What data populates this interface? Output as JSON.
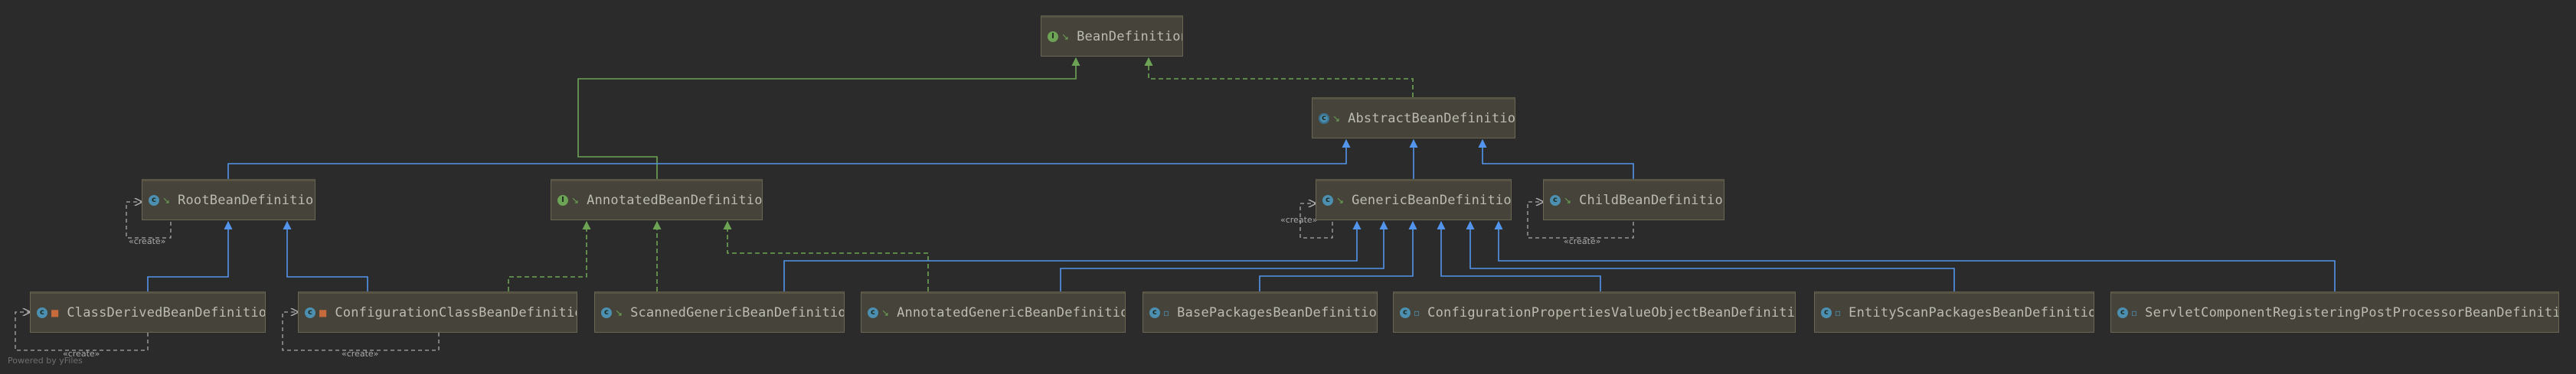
{
  "colors": {
    "background": "#2b2b2b",
    "node_fill": "#45433a",
    "node_border": "#6b6754",
    "node_text": "#bcbcb0",
    "extends_edge": "#5394ec",
    "implements_edge": "#6da355",
    "dependency_edge": "#a9a9a9"
  },
  "nodes": [
    {
      "id": "BeanDefinition",
      "label": "BeanDefinition",
      "kind": "interface",
      "kind_icon": "interface-icon",
      "access": "public"
    },
    {
      "id": "AbstractBeanDefinition",
      "label": "AbstractBeanDefinition",
      "kind": "abstract-class",
      "kind_icon": "abstract-class-icon",
      "access": "public"
    },
    {
      "id": "RootBeanDefinition",
      "label": "RootBeanDefinition",
      "kind": "class",
      "kind_icon": "class-icon",
      "access": "public"
    },
    {
      "id": "AnnotatedBeanDefinition",
      "label": "AnnotatedBeanDefinition",
      "kind": "interface",
      "kind_icon": "interface-icon",
      "access": "public"
    },
    {
      "id": "GenericBeanDefinition",
      "label": "GenericBeanDefinition",
      "kind": "class",
      "kind_icon": "class-icon",
      "access": "public"
    },
    {
      "id": "ChildBeanDefinition",
      "label": "ChildBeanDefinition",
      "kind": "class",
      "kind_icon": "class-icon",
      "access": "public"
    },
    {
      "id": "ClassDerivedBeanDefinition",
      "label": "ClassDerivedBeanDefinition",
      "kind": "class",
      "kind_icon": "class-icon",
      "access": "private"
    },
    {
      "id": "ConfigurationClassBeanDefinition",
      "label": "ConfigurationClassBeanDefinition",
      "kind": "class",
      "kind_icon": "class-icon",
      "access": "private"
    },
    {
      "id": "ScannedGenericBeanDefinition",
      "label": "ScannedGenericBeanDefinition",
      "kind": "class",
      "kind_icon": "class-icon",
      "access": "public"
    },
    {
      "id": "AnnotatedGenericBeanDefinition",
      "label": "AnnotatedGenericBeanDefinition",
      "kind": "class",
      "kind_icon": "class-icon",
      "access": "public"
    },
    {
      "id": "BasePackagesBeanDefinition",
      "label": "BasePackagesBeanDefinition",
      "kind": "class",
      "kind_icon": "class-icon",
      "access": "default"
    },
    {
      "id": "ConfigurationPropertiesValueObjectBeanDefinition",
      "label": "ConfigurationPropertiesValueObjectBeanDefinition",
      "kind": "class",
      "kind_icon": "class-icon",
      "access": "default"
    },
    {
      "id": "EntityScanPackagesBeanDefinition",
      "label": "EntityScanPackagesBeanDefinition",
      "kind": "class",
      "kind_icon": "class-icon",
      "access": "default"
    },
    {
      "id": "ServletComponentRegisteringPostProcessorBeanDefinition",
      "label": "ServletComponentRegisteringPostProcessorBeanDefinition",
      "kind": "class",
      "kind_icon": "class-icon",
      "access": "default"
    }
  ],
  "edges": [
    {
      "from": "AbstractBeanDefinition",
      "to": "BeanDefinition",
      "type": "implements"
    },
    {
      "from": "AnnotatedBeanDefinition",
      "to": "BeanDefinition",
      "type": "extends-interface"
    },
    {
      "from": "RootBeanDefinition",
      "to": "AbstractBeanDefinition",
      "type": "extends"
    },
    {
      "from": "GenericBeanDefinition",
      "to": "AbstractBeanDefinition",
      "type": "extends"
    },
    {
      "from": "ChildBeanDefinition",
      "to": "AbstractBeanDefinition",
      "type": "extends"
    },
    {
      "from": "ClassDerivedBeanDefinition",
      "to": "RootBeanDefinition",
      "type": "extends"
    },
    {
      "from": "ConfigurationClassBeanDefinition",
      "to": "RootBeanDefinition",
      "type": "extends"
    },
    {
      "from": "ConfigurationClassBeanDefinition",
      "to": "AnnotatedBeanDefinition",
      "type": "implements"
    },
    {
      "from": "ScannedGenericBeanDefinition",
      "to": "AnnotatedBeanDefinition",
      "type": "implements"
    },
    {
      "from": "AnnotatedGenericBeanDefinition",
      "to": "AnnotatedBeanDefinition",
      "type": "implements"
    },
    {
      "from": "ScannedGenericBeanDefinition",
      "to": "GenericBeanDefinition",
      "type": "extends"
    },
    {
      "from": "AnnotatedGenericBeanDefinition",
      "to": "GenericBeanDefinition",
      "type": "extends"
    },
    {
      "from": "BasePackagesBeanDefinition",
      "to": "GenericBeanDefinition",
      "type": "extends"
    },
    {
      "from": "ConfigurationPropertiesValueObjectBeanDefinition",
      "to": "GenericBeanDefinition",
      "type": "extends"
    },
    {
      "from": "EntityScanPackagesBeanDefinition",
      "to": "GenericBeanDefinition",
      "type": "extends"
    },
    {
      "from": "ServletComponentRegisteringPostProcessorBeanDefinition",
      "to": "GenericBeanDefinition",
      "type": "extends"
    }
  ],
  "self_dependencies": [
    {
      "node": "RootBeanDefinition",
      "label": "«create»"
    },
    {
      "node": "GenericBeanDefinition",
      "label": "«create»"
    },
    {
      "node": "ChildBeanDefinition",
      "label": "«create»"
    },
    {
      "node": "ClassDerivedBeanDefinition",
      "label": "«create»"
    },
    {
      "node": "ConfigurationClassBeanDefinition",
      "label": "«create»"
    }
  ],
  "watermark": "Powered by yFiles"
}
